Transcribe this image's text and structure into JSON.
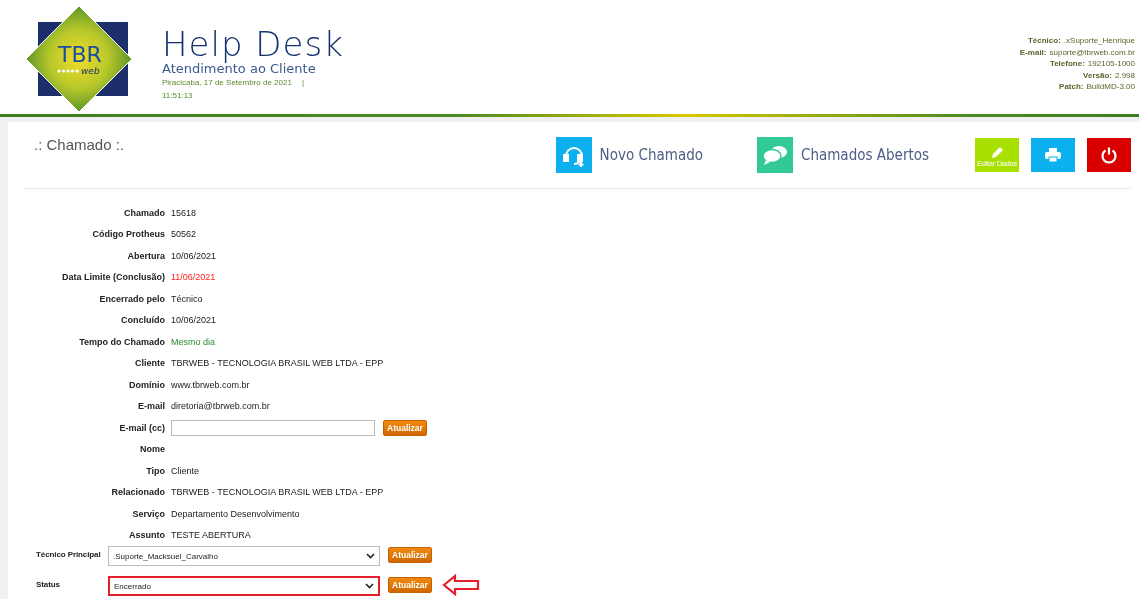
{
  "header": {
    "logo": {
      "text": "TBR",
      "subtext": "web"
    },
    "title": "Help Desk",
    "subtitle": "Atendimento ao Cliente",
    "date": "Piracicaba, 17 de Setembro de 2021",
    "separator": "|",
    "time": "11:51:13",
    "info": [
      {
        "label": "Técnico:",
        "value": ".xSuporte_Henrique"
      },
      {
        "label": "E-mail:",
        "value": "suporte@tbrweb.com.br"
      },
      {
        "label": "Telefone:",
        "value": "192105-1000"
      },
      {
        "label": "Versão:",
        "value": "2.998"
      },
      {
        "label": "Patch:",
        "value": "BuildMD-3.00"
      }
    ]
  },
  "page_title": ".: Chamado :.",
  "toolbar": [
    {
      "kind": "headset",
      "label": "Novo Chamado"
    },
    {
      "kind": "chat",
      "label": "Chamados Abertos"
    },
    {
      "kind": "edit",
      "label": "Editar Dados"
    },
    {
      "kind": "print"
    },
    {
      "kind": "power"
    }
  ],
  "fields": [
    {
      "kind": "text",
      "label": "Chamado",
      "value": "15618"
    },
    {
      "kind": "text",
      "label": "Código Protheus",
      "value": "50562"
    },
    {
      "kind": "text",
      "label": "Abertura",
      "value": "10/06/2021"
    },
    {
      "kind": "late",
      "label": "Data Limite (Conclusão)",
      "value": "11/06/2021"
    },
    {
      "kind": "text",
      "label": "Encerrado pelo",
      "value": "Técnico"
    },
    {
      "kind": "text",
      "label": "Concluído",
      "value": "10/06/2021"
    },
    {
      "kind": "good",
      "label": "Tempo do Chamado",
      "value": "Mesmo dia"
    },
    {
      "kind": "text",
      "label": "Cliente",
      "value": "TBRWEB - TECNOLOGIA BRASIL WEB LTDA - EPP"
    },
    {
      "kind": "text",
      "label": "Domínio",
      "value": "www.tbrweb.com.br"
    },
    {
      "kind": "text",
      "label": "E-mail",
      "value": "diretoria@tbrweb.com.br"
    },
    {
      "kind": "input",
      "label": "E-mail (cc)",
      "button": "Atualizar"
    },
    {
      "kind": "text",
      "label": "Nome"
    },
    {
      "kind": "text",
      "label": "Tipo",
      "value": "Cliente"
    },
    {
      "kind": "text",
      "label": "Relacionado",
      "value": "TBRWEB - TECNOLOGIA BRASIL WEB LTDA - EPP"
    },
    {
      "kind": "text",
      "label": "Serviço",
      "value": "Departamento Desenvolvimento"
    },
    {
      "kind": "text",
      "label": "Assunto",
      "value": "TESTE ABERTURA"
    },
    {
      "kind": "select",
      "label": "Técnico Principal",
      "value": ".Suporte_Macksuel_Carvalho",
      "button": "Atualizar",
      "highlighted": false
    },
    {
      "kind": "select",
      "label": "Status",
      "value": "Encerrado",
      "button": "Atualizar",
      "highlighted": true
    }
  ]
}
